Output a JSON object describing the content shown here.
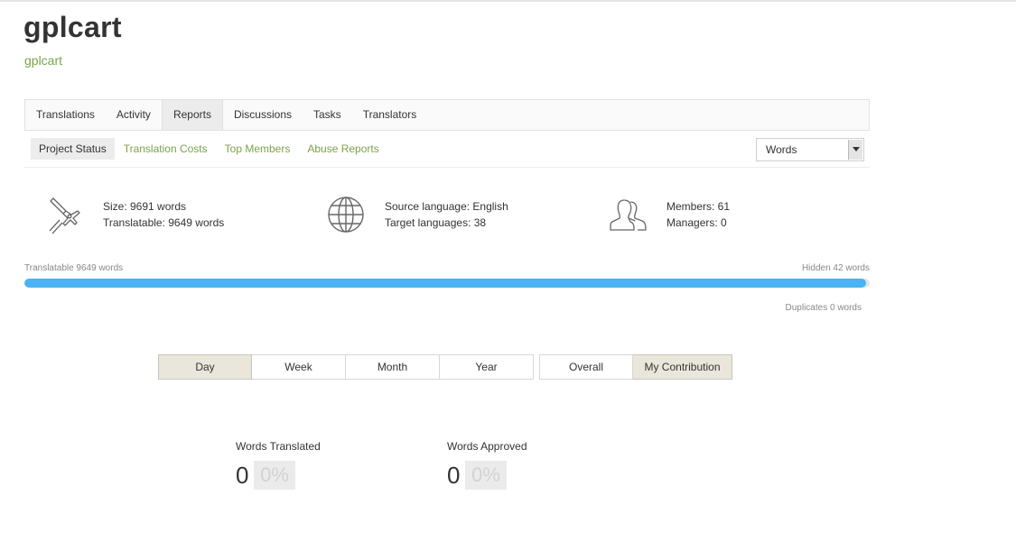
{
  "project": {
    "title": "gplcart",
    "subtitle": "gplcart"
  },
  "main_tabs": [
    {
      "label": "Translations"
    },
    {
      "label": "Activity"
    },
    {
      "label": "Reports"
    },
    {
      "label": "Discussions"
    },
    {
      "label": "Tasks"
    },
    {
      "label": "Translators"
    }
  ],
  "active_main_tab": "Reports",
  "sub_tabs": [
    {
      "label": "Project Status"
    },
    {
      "label": "Translation Costs"
    },
    {
      "label": "Top Members"
    },
    {
      "label": "Abuse Reports"
    }
  ],
  "active_sub_tab": "Project Status",
  "unit_select": {
    "value": "Words"
  },
  "stats": {
    "size": {
      "icon": "caliper-icon",
      "line1": "Size: 9691 words",
      "line2": "Translatable: 9649 words"
    },
    "languages": {
      "icon": "globe-icon",
      "line1": "Source language: English",
      "line2": "Target languages: 38"
    },
    "members": {
      "icon": "members-icon",
      "line1": "Members: 61",
      "line2": "Managers: 0"
    }
  },
  "progress": {
    "left_label": "Translatable 9649 words",
    "right_label": "Hidden 42 words",
    "translatable_fraction": 0.9957,
    "bar_color": "#4ab3f4",
    "duplicates_label": "Duplicates 0 words"
  },
  "period_buttons": [
    {
      "label": "Day",
      "active": true
    },
    {
      "label": "Week",
      "active": false
    },
    {
      "label": "Month",
      "active": false
    },
    {
      "label": "Year",
      "active": false
    }
  ],
  "scope_buttons": [
    {
      "label": "Overall",
      "active": false
    },
    {
      "label": "My Contribution",
      "active": true
    }
  ],
  "metrics": {
    "translated": {
      "label": "Words Translated",
      "value": "0",
      "percent": "0%"
    },
    "approved": {
      "label": "Words Approved",
      "value": "0",
      "percent": "0%"
    }
  },
  "colors": {
    "accent_green": "#7aa34a",
    "active_button": "#e9e7db"
  }
}
